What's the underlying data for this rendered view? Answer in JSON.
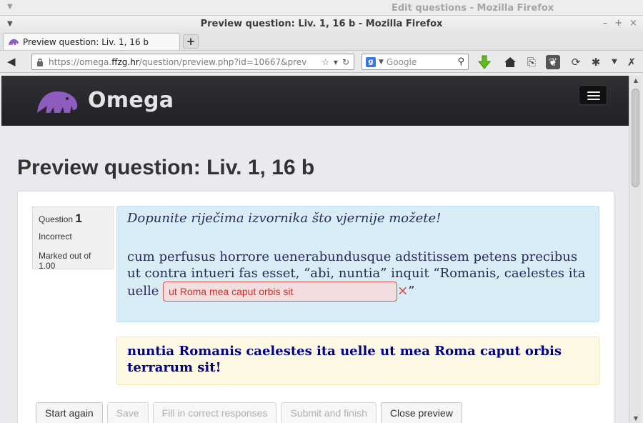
{
  "background_window": {
    "title": "Edit questions - Mozilla Firefox"
  },
  "window": {
    "title": "Preview question: Liv. 1, 16 b - Mozilla Firefox",
    "controls": {
      "minimize": "–",
      "maximize": "+",
      "close": "×"
    }
  },
  "tab": {
    "label": "Preview question: Liv. 1, 16 b",
    "new_tab": "+"
  },
  "navbar": {
    "url_prefix": "https://omega.",
    "url_domain": "ffzg.hr",
    "url_rest": "/question/preview.php?id=10667&prev",
    "search_placeholder": "Google"
  },
  "site": {
    "brand": "Omega"
  },
  "page": {
    "title": "Preview question: Liv. 1, 16 b"
  },
  "question_info": {
    "label": "Question",
    "number": "1",
    "state": "Incorrect",
    "grade": "Marked out of 1.00"
  },
  "question": {
    "instruction": "Dopunite riječima izvornika što vjernije možete!",
    "text_before": "cum perfusus horrore uenerabundusque adstitissem petens precibus ut contra intueri fas esset, “abi, nuntia” inquit “Romanis, caelestes ita uelle ",
    "answer": "ut Roma mea caput orbis sit",
    "wrong_mark": "✕",
    "text_after": "”"
  },
  "feedback": {
    "text": "nuntia Romanis caelestes ita uelle ut mea Roma caput orbis terrarum sit!"
  },
  "buttons": {
    "start_again": "Start again",
    "save": "Save",
    "fill_correct": "Fill in correct responses",
    "submit_finish": "Submit and finish",
    "close_preview": "Close preview"
  },
  "colors": {
    "header_bg": "#26282b",
    "logo_purple": "#8e5bbf",
    "formulation_bg": "#d9edf7",
    "feedback_bg": "#fcf8e3",
    "incorrect_red": "#d9534f",
    "feedback_text": "#000080"
  }
}
